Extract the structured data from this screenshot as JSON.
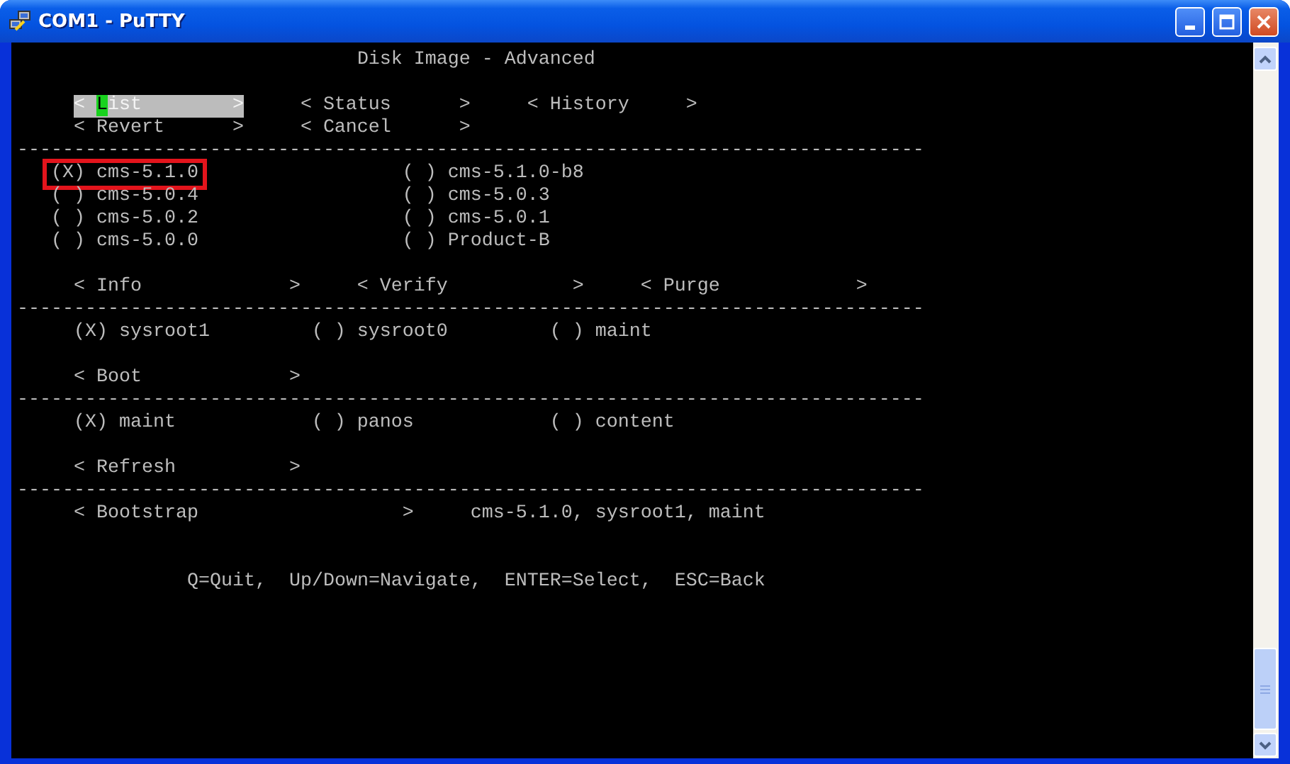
{
  "window": {
    "title": "COM1 - PuTTY"
  },
  "terminal": [
    {
      "kind": "heading",
      "text": "Disk Image - Advanced"
    },
    {
      "kind": "menu_narrow",
      "rows": [
        [
          {
            "open": "<",
            "label": "List",
            "close": ">",
            "selected": true
          },
          {
            "open": "<",
            "label": "Status",
            "close": ">",
            "selected": false
          },
          {
            "open": "<",
            "label": "History",
            "close": ">",
            "selected": false
          }
        ],
        [
          {
            "open": "<",
            "label": "Revert",
            "close": ">",
            "selected": false
          },
          {
            "open": "<",
            "label": "Cancel",
            "close": ">",
            "selected": false
          }
        ]
      ]
    },
    {
      "kind": "rule",
      "text": "--------------------------------------------------------------------------------"
    },
    {
      "kind": "image_list",
      "rows": [
        [
          {
            "mark": "(X)",
            "name": "cms-5.1.0",
            "boxed": true
          },
          {
            "mark": "( )",
            "name": "cms-5.1.0-b8",
            "boxed": false
          }
        ],
        [
          {
            "mark": "( )",
            "name": "cms-5.0.4",
            "boxed": false
          },
          {
            "mark": "( )",
            "name": "cms-5.0.3",
            "boxed": false
          }
        ],
        [
          {
            "mark": "( )",
            "name": "cms-5.0.2",
            "boxed": false
          },
          {
            "mark": "( )",
            "name": "cms-5.0.1",
            "boxed": false
          }
        ],
        [
          {
            "mark": "( )",
            "name": "cms-5.0.0",
            "boxed": false
          },
          {
            "mark": "( )",
            "name": "Product-B",
            "boxed": false
          }
        ]
      ]
    },
    {
      "kind": "menu_wide",
      "rows": [
        [
          {
            "open": "<",
            "label": "Info",
            "close": ">",
            "selected": false
          },
          {
            "open": "<",
            "label": "Verify",
            "close": ">",
            "selected": false
          },
          {
            "open": "<",
            "label": "Purge",
            "close": ">",
            "selected": false
          }
        ]
      ]
    },
    {
      "kind": "rule",
      "text": "--------------------------------------------------------------------------------"
    },
    {
      "kind": "choice_row",
      "rows": [
        [
          {
            "mark": "(X)",
            "name": "sysroot1",
            "boxed": false
          },
          {
            "mark": "( )",
            "name": "sysroot0",
            "boxed": false
          },
          {
            "mark": "( )",
            "name": "maint",
            "boxed": false
          }
        ]
      ]
    },
    {
      "kind": "menu_wide",
      "rows": [
        [
          {
            "open": "<",
            "label": "Boot",
            "close": ">",
            "selected": false
          }
        ]
      ]
    },
    {
      "kind": "rule",
      "text": "--------------------------------------------------------------------------------"
    },
    {
      "kind": "choice_row",
      "rows": [
        [
          {
            "mark": "(X)",
            "name": "maint",
            "boxed": false
          },
          {
            "mark": "( )",
            "name": "panos",
            "boxed": false
          },
          {
            "mark": "( )",
            "name": "content",
            "boxed": false
          }
        ]
      ]
    },
    {
      "kind": "menu_wide",
      "rows": [
        [
          {
            "open": "<",
            "label": "Refresh",
            "close": ">",
            "selected": false
          }
        ]
      ]
    },
    {
      "kind": "rule",
      "text": "--------------------------------------------------------------------------------"
    },
    {
      "kind": "action",
      "button": {
        "open": "<",
        "label": "Bootstrap",
        "close": ">",
        "selected": false
      },
      "summary": "cms-5.1.0, sysroot1, maint"
    },
    {
      "kind": "help",
      "text": "Q=Quit,  Up/Down=Navigate,  ENTER=Select,  ESC=Back"
    }
  ]
}
